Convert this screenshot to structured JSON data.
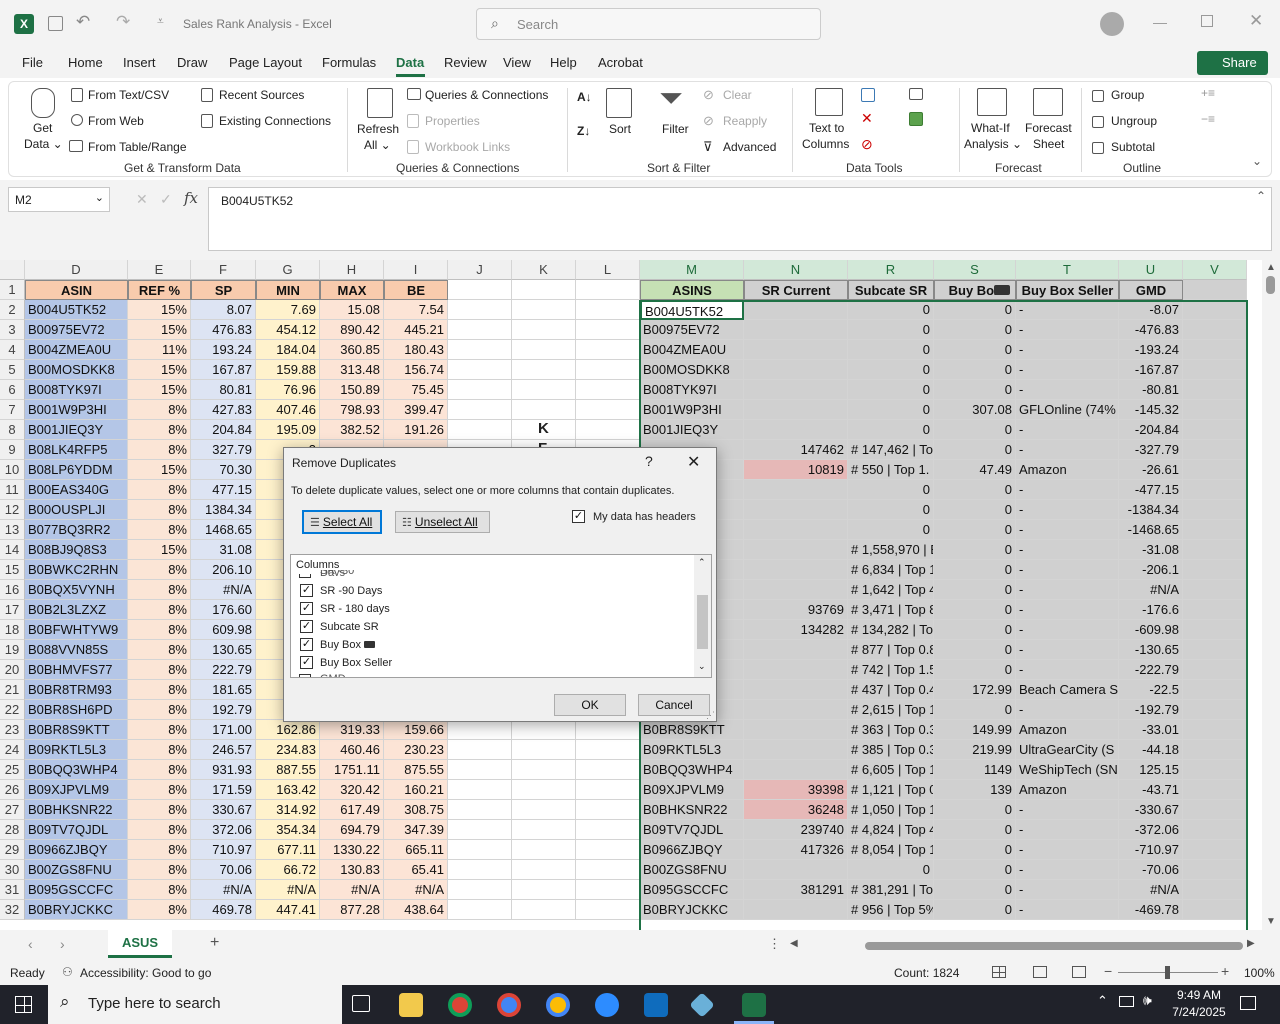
{
  "window": {
    "title": "Sales Rank Analysis  -  Excel",
    "search_placeholder": "Search"
  },
  "menu": [
    "File",
    "Home",
    "Insert",
    "Draw",
    "Page Layout",
    "Formulas",
    "Data",
    "Review",
    "View",
    "Help",
    "Acrobat"
  ],
  "share_label": "Share",
  "ribbon": {
    "get_data": "Get",
    "get_data2": "Data ⌄",
    "from_text": "From Text/CSV",
    "from_web": "From Web",
    "from_table": "From Table/Range",
    "recent_sources": "Recent Sources",
    "existing_connections": "Existing Connections",
    "refresh": "Refresh",
    "refresh2": "All ⌄",
    "queries": "Queries & Connections",
    "properties": "Properties",
    "workbook_links": "Workbook Links",
    "sort": "Sort",
    "filter": "Filter",
    "clear": "Clear",
    "reapply": "Reapply",
    "advanced": "Advanced",
    "text_to_columns": "Text to",
    "text_to_columns2": "Columns",
    "what_if": "What-If",
    "what_if2": "Analysis ⌄",
    "forecast_sheet": "Forecast",
    "forecast_sheet2": "Sheet",
    "group": "Group",
    "ungroup": "Ungroup",
    "subtotal": "Subtotal",
    "groups": [
      "Get & Transform Data",
      "Queries & Connections",
      "Sort & Filter",
      "Data Tools",
      "Forecast",
      "Outline"
    ]
  },
  "formula_bar": {
    "name_box": "M2",
    "formula": "B004U5TK52"
  },
  "columns_left": [
    "D",
    "E",
    "F",
    "G",
    "H",
    "I",
    "J",
    "K",
    "L"
  ],
  "columns_right": [
    "M",
    "N",
    "R",
    "S",
    "T",
    "U",
    "V"
  ],
  "headers_left": [
    "ASIN",
    "REF %",
    "SP",
    "MIN",
    "MAX",
    "BE"
  ],
  "headers_right": [
    "ASINS",
    "SR Current",
    "Subcate SR",
    "Buy Box",
    "Buy Box Seller",
    "GMD"
  ],
  "rows": [
    {
      "n": "2",
      "d": "B004U5TK52",
      "e": "15%",
      "f": "8.07",
      "g": "7.69",
      "h": "15.08",
      "i": "7.54",
      "m": "B004U5TK52",
      "nn": "",
      "r": "",
      "rv": "0",
      "s": "0",
      "t": "-",
      "u": "-8.07"
    },
    {
      "n": "3",
      "d": "B00975EV72",
      "e": "15%",
      "f": "476.83",
      "g": "454.12",
      "h": "890.42",
      "i": "445.21",
      "m": "B00975EV72",
      "nn": "",
      "r": "",
      "rv": "0",
      "s": "0",
      "t": "-",
      "u": "-476.83"
    },
    {
      "n": "4",
      "d": "B004ZMEA0U",
      "e": "11%",
      "f": "193.24",
      "g": "184.04",
      "h": "360.85",
      "i": "180.43",
      "m": "B004ZMEA0U",
      "nn": "",
      "r": "",
      "rv": "0",
      "s": "0",
      "t": "-",
      "u": "-193.24"
    },
    {
      "n": "5",
      "d": "B00MOSDKK8",
      "e": "15%",
      "f": "167.87",
      "g": "159.88",
      "h": "313.48",
      "i": "156.74",
      "m": "B00MOSDKK8",
      "nn": "",
      "r": "",
      "rv": "0",
      "s": "0",
      "t": "-",
      "u": "-167.87"
    },
    {
      "n": "6",
      "d": "B008TYK97I",
      "e": "15%",
      "f": "80.81",
      "g": "76.96",
      "h": "150.89",
      "i": "75.45",
      "m": "B008TYK97I",
      "nn": "",
      "r": "",
      "rv": "0",
      "s": "0",
      "t": "-",
      "u": "-80.81"
    },
    {
      "n": "7",
      "d": "B001W9P3HI",
      "e": "8%",
      "f": "427.83",
      "g": "407.46",
      "h": "798.93",
      "i": "399.47",
      "m": "B001W9P3HI",
      "nn": "",
      "r": "",
      "rv": "0",
      "s": "307.08",
      "t": "GFLOnline (74%",
      "u": "-145.32"
    },
    {
      "n": "8",
      "d": "B001JIEQ3Y",
      "e": "8%",
      "f": "204.84",
      "g": "195.09",
      "h": "382.52",
      "i": "191.26",
      "m": "B001JIEQ3Y",
      "nn": "",
      "r": "",
      "rv": "0",
      "s": "0",
      "t": "-",
      "u": "-204.84"
    },
    {
      "n": "9",
      "d": "B08LK4RFP5",
      "e": "8%",
      "f": "327.79",
      "g": "3",
      "h": "",
      "i": "",
      "m": "",
      "nn": "147462",
      "r": "# 147,462 | To",
      "rv": "",
      "s": "0",
      "t": "-",
      "u": "-327.79"
    },
    {
      "n": "10",
      "d": "B08LP6YDDM",
      "e": "15%",
      "f": "70.30",
      "g": "",
      "h": "",
      "i": "",
      "m": "",
      "nn": "10819",
      "r": "# 550 | Top 1.",
      "rv": "",
      "s": "47.49",
      "t": "Amazon",
      "u": "-26.61",
      "pink": true
    },
    {
      "n": "11",
      "d": "B00EAS340G",
      "e": "8%",
      "f": "477.15",
      "g": "4",
      "h": "",
      "i": "",
      "m": "",
      "nn": "",
      "r": "",
      "rv": "0",
      "s": "0",
      "t": "-",
      "u": "-477.15"
    },
    {
      "n": "12",
      "d": "B00OUSPLJI",
      "e": "8%",
      "f": "1384.34",
      "g": "13",
      "h": "",
      "i": "",
      "m": "",
      "nn": "",
      "r": "",
      "rv": "0",
      "s": "0",
      "t": "-",
      "u": "-1384.34"
    },
    {
      "n": "13",
      "d": "B077BQ3RR2",
      "e": "8%",
      "f": "1468.65",
      "g": "13",
      "h": "",
      "i": "",
      "m": "",
      "nn": "",
      "r": "",
      "rv": "0",
      "s": "0",
      "t": "-",
      "u": "-1468.65"
    },
    {
      "n": "14",
      "d": "B08BJ9Q8S3",
      "e": "15%",
      "f": "31.08",
      "g": "",
      "h": "",
      "i": "",
      "m": "",
      "nn": "",
      "r": "# 1,558,970 | E",
      "rv": "",
      "s": "0",
      "t": "-",
      "u": "-31.08"
    },
    {
      "n": "15",
      "d": "B0BWKC2RHN",
      "e": "8%",
      "f": "206.10",
      "g": "1",
      "h": "",
      "i": "",
      "m": "N",
      "nn": "",
      "r": "# 6,834 | Top 1",
      "rv": "",
      "s": "0",
      "t": "-",
      "u": "-206.1"
    },
    {
      "n": "16",
      "d": "B0BQX5VYNH",
      "e": "8%",
      "f": "#N/A",
      "g": "#N",
      "h": "",
      "i": "",
      "m": "H",
      "nn": "",
      "r": "# 1,642 | Top 4",
      "rv": "",
      "s": "0",
      "t": "-",
      "u": "#N/A"
    },
    {
      "n": "17",
      "d": "B0B2L3LZXZ",
      "e": "8%",
      "f": "176.60",
      "g": "1",
      "h": "",
      "i": "",
      "m": "",
      "nn": "93769",
      "r": "# 3,471 | Top 8",
      "rv": "",
      "s": "0",
      "t": "-",
      "u": "-176.6"
    },
    {
      "n": "18",
      "d": "B0BFWHTYW9",
      "e": "8%",
      "f": "609.98",
      "g": "5",
      "h": "",
      "i": "",
      "m": "/9",
      "nn": "134282",
      "r": "# 134,282 | To",
      "rv": "",
      "s": "0",
      "t": "-",
      "u": "-609.98"
    },
    {
      "n": "19",
      "d": "B088VVN85S",
      "e": "8%",
      "f": "130.65",
      "g": "1",
      "h": "",
      "i": "",
      "m": "S",
      "nn": "",
      "r": "# 877 | Top 0.8",
      "rv": "",
      "s": "0",
      "t": "-",
      "u": "-130.65"
    },
    {
      "n": "20",
      "d": "B0BHMVFS77",
      "e": "8%",
      "f": "222.79",
      "g": "2",
      "h": "",
      "i": "",
      "m": "7",
      "nn": "",
      "r": "# 742 | Top 1.5",
      "rv": "",
      "s": "0",
      "t": "-",
      "u": "-222.79"
    },
    {
      "n": "21",
      "d": "B0BR8TRM93",
      "e": "8%",
      "f": "181.65",
      "g": "1",
      "h": "",
      "i": "",
      "m": "3",
      "nn": "",
      "r": "# 437 | Top 0.4",
      "rv": "",
      "s": "172.99",
      "t": "Beach Camera Sa",
      "u": "-22.5"
    },
    {
      "n": "22",
      "d": "B0BR8SH6PD",
      "e": "8%",
      "f": "192.79",
      "g": "1",
      "h": "",
      "i": "",
      "m": "D",
      "nn": "",
      "r": "# 2,615 | Top 1",
      "rv": "",
      "s": "0",
      "t": "-",
      "u": "-192.79"
    },
    {
      "n": "23",
      "d": "B0BR8S9KTT",
      "e": "8%",
      "f": "171.00",
      "g": "162.86",
      "h": "319.33",
      "i": "159.66",
      "m": "B0BR8S9KTT",
      "nn": "",
      "r": "# 363 | Top 0.3",
      "rv": "",
      "s": "149.99",
      "t": "Amazon",
      "u": "-33.01"
    },
    {
      "n": "24",
      "d": "B09RKTL5L3",
      "e": "8%",
      "f": "246.57",
      "g": "234.83",
      "h": "460.46",
      "i": "230.23",
      "m": "B09RKTL5L3",
      "nn": "",
      "r": "# 385 | Top 0.3",
      "rv": "",
      "s": "219.99",
      "t": "UltraGearCity (S",
      "u": "-44.18"
    },
    {
      "n": "25",
      "d": "B0BQQ3WHP4",
      "e": "8%",
      "f": "931.93",
      "g": "887.55",
      "h": "1751.11",
      "i": "875.55",
      "m": "B0BQQ3WHP4",
      "nn": "",
      "r": "# 6,605 | Top 1",
      "rv": "",
      "s": "1149",
      "t": "WeShipTech (SN",
      "u": "125.15"
    },
    {
      "n": "26",
      "d": "B09XJPVLM9",
      "e": "8%",
      "f": "171.59",
      "g": "163.42",
      "h": "320.42",
      "i": "160.21",
      "m": "B09XJPVLM9",
      "nn": "39398",
      "r": "# 1,121 | Top 0",
      "rv": "",
      "s": "139",
      "t": "Amazon",
      "u": "-43.71",
      "pink": true
    },
    {
      "n": "27",
      "d": "B0BHKSNR22",
      "e": "8%",
      "f": "330.67",
      "g": "314.92",
      "h": "617.49",
      "i": "308.75",
      "m": "B0BHKSNR22",
      "nn": "36248",
      "r": "# 1,050 | Top 1",
      "rv": "",
      "s": "0",
      "t": "-",
      "u": "-330.67",
      "pink": true
    },
    {
      "n": "28",
      "d": "B09TV7QJDL",
      "e": "8%",
      "f": "372.06",
      "g": "354.34",
      "h": "694.79",
      "i": "347.39",
      "m": "B09TV7QJDL",
      "nn": "239740",
      "r": "# 4,824 | Top 4",
      "rv": "",
      "s": "0",
      "t": "-",
      "u": "-372.06"
    },
    {
      "n": "29",
      "d": "B0966ZJBQY",
      "e": "8%",
      "f": "710.97",
      "g": "677.11",
      "h": "1330.22",
      "i": "665.11",
      "m": "B0966ZJBQY",
      "nn": "417326",
      "r": "# 8,054 | Top 1",
      "rv": "",
      "s": "0",
      "t": "-",
      "u": "-710.97"
    },
    {
      "n": "30",
      "d": "B00ZGS8FNU",
      "e": "8%",
      "f": "70.06",
      "g": "66.72",
      "h": "130.83",
      "i": "65.41",
      "m": "B00ZGS8FNU",
      "nn": "",
      "r": "",
      "rv": "0",
      "s": "0",
      "t": "-",
      "u": "-70.06"
    },
    {
      "n": "31",
      "d": "B095GSCCFC",
      "e": "8%",
      "f": "#N/A",
      "g": "#N/A",
      "h": "#N/A",
      "i": "#N/A",
      "m": "B095GSCCFC",
      "nn": "381291",
      "r": "# 381,291 | To",
      "rv": "",
      "s": "0",
      "t": "-",
      "u": "#N/A"
    },
    {
      "n": "32",
      "d": "B0BRYJCKKC",
      "e": "8%",
      "f": "469.78",
      "g": "447.41",
      "h": "877.28",
      "i": "438.64",
      "m": "B0BRYJCKKC",
      "nn": "",
      "r": "# 956 | Top 5%",
      "rv": "",
      "s": "0",
      "t": "-",
      "u": "-469.78"
    }
  ],
  "k_labels": [
    "K",
    "F"
  ],
  "dialog": {
    "title": "Remove Duplicates",
    "help": "?",
    "instruction": "To delete duplicate values, select one or more columns that contain duplicates.",
    "select_all": "Select All",
    "unselect_all": "Unselect All",
    "has_headers": "My data has headers",
    "columns_label": "Columns",
    "columns": [
      "SR -90 Days",
      "SR - 180 days",
      "Subcate SR",
      "Buy Box",
      "Buy Box Seller"
    ],
    "ok": "OK",
    "cancel": "Cancel"
  },
  "sheet_tab": "ASUS",
  "status": {
    "ready": "Ready",
    "accessibility": "Accessibility: Good to go",
    "count": "Count: 1824",
    "zoom": "100%"
  },
  "taskbar": {
    "search_placeholder": "Type here to search",
    "time": "9:49 AM",
    "date": "7/24/2025"
  },
  "colors": {
    "accent": "#1e7145",
    "asin_fill": "#b4c6e7",
    "ref_fill": "#fbe5d6",
    "sp_fill": "#dde4f3",
    "min_fill": "#fff2cc",
    "max_fill": "#fce4d6",
    "header_fill": "#f8cbad",
    "gray_fill": "#d0d0d0",
    "pink_fill": "#e6b8b7",
    "m_header_fill": "#c6e0b4"
  }
}
